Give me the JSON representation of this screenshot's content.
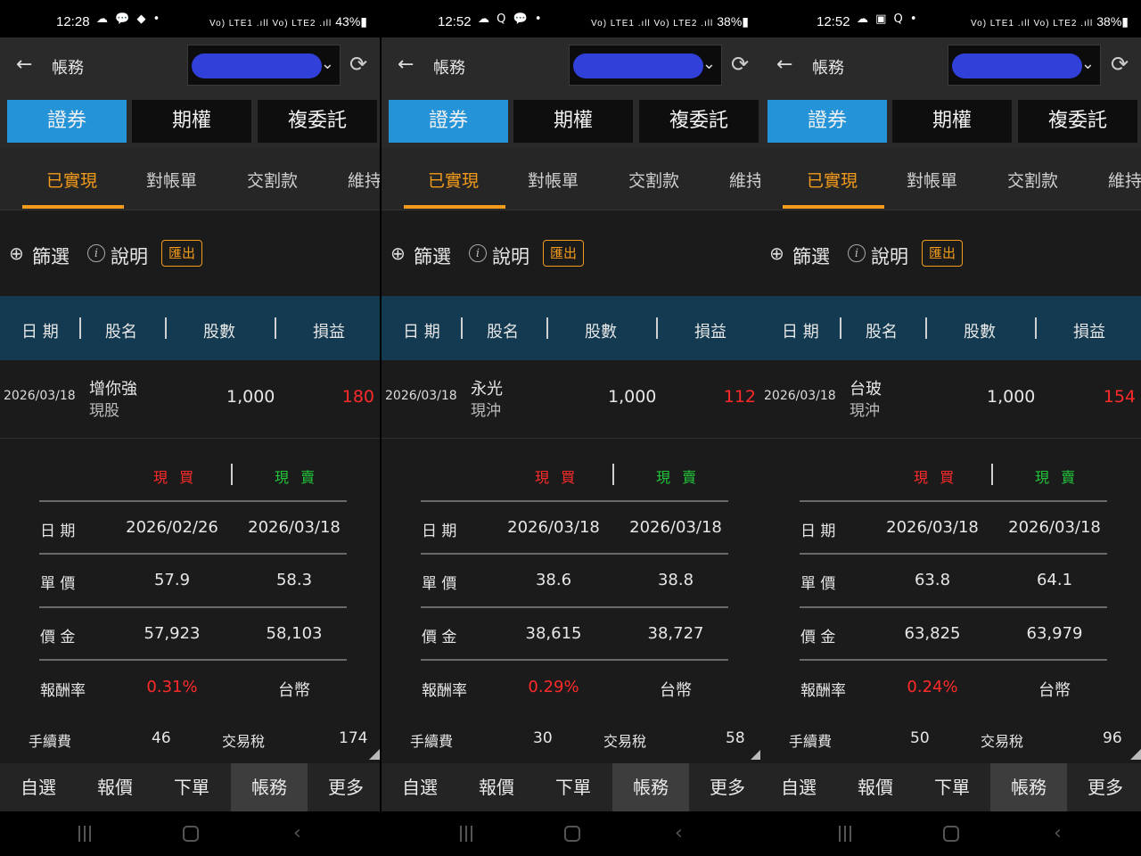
{
  "screens": [
    {
      "status": {
        "time": "12:28",
        "left_icons": "☁ 💬 ◆ •",
        "signal": "Vo) LTE1 .ıll Vo) LTE2 .ıll",
        "battery": "43%"
      },
      "appbar": {
        "title": "帳務",
        "account_redacted": true
      },
      "segments": [
        "證券",
        "期權",
        "複委託"
      ],
      "subtabs": [
        "已實現",
        "對帳單",
        "交割款",
        "維持"
      ],
      "filter": {
        "filter_label": "篩選",
        "info_label": "說明",
        "export_label": "匯出"
      },
      "table_head": [
        "日 期",
        "股名",
        "股數",
        "損益"
      ],
      "row": {
        "date": "2026/03/18",
        "name": "增你強",
        "type": "現股",
        "shares": "1,000",
        "pnl": "180"
      },
      "detail": {
        "buy_label": "現 買",
        "sell_label": "現 賣",
        "date_label": "日 期",
        "buy_date": "2026/02/26",
        "sell_date": "2026/03/18",
        "price_label": "單 價",
        "buy_price": "57.9",
        "sell_price": "58.3",
        "amount_label": "價 金",
        "buy_amount": "57,923",
        "sell_amount": "58,103",
        "return_label": "報酬率",
        "return_rate": "0.31%",
        "currency": "台幣",
        "fee_label": "手續費",
        "fee": "46",
        "tax_label": "交易稅",
        "tax": "174"
      },
      "nav": [
        "自選",
        "報價",
        "下單",
        "帳務",
        "更多"
      ]
    },
    {
      "status": {
        "time": "12:52",
        "left_icons": "☁ Q 💬 •",
        "signal": "Vo) LTE1 .ıll Vo) LTE2 .ıll",
        "battery": "38%"
      },
      "appbar": {
        "title": "帳務",
        "account_redacted": true
      },
      "segments": [
        "證券",
        "期權",
        "複委託"
      ],
      "subtabs": [
        "已實現",
        "對帳單",
        "交割款",
        "維持"
      ],
      "filter": {
        "filter_label": "篩選",
        "info_label": "說明",
        "export_label": "匯出"
      },
      "table_head": [
        "日 期",
        "股名",
        "股數",
        "損益"
      ],
      "row": {
        "date": "2026/03/18",
        "name": "永光",
        "type": "現沖",
        "shares": "1,000",
        "pnl": "112"
      },
      "detail": {
        "buy_label": "現 買",
        "sell_label": "現 賣",
        "date_label": "日 期",
        "buy_date": "2026/03/18",
        "sell_date": "2026/03/18",
        "price_label": "單 價",
        "buy_price": "38.6",
        "sell_price": "38.8",
        "amount_label": "價 金",
        "buy_amount": "38,615",
        "sell_amount": "38,727",
        "return_label": "報酬率",
        "return_rate": "0.29%",
        "currency": "台幣",
        "fee_label": "手續費",
        "fee": "30",
        "tax_label": "交易稅",
        "tax": "58"
      },
      "nav": [
        "自選",
        "報價",
        "下單",
        "帳務",
        "更多"
      ]
    },
    {
      "status": {
        "time": "12:52",
        "left_icons": "☁ ▣ Q •",
        "signal": "Vo) LTE1 .ıll Vo) LTE2 .ıll",
        "battery": "38%"
      },
      "appbar": {
        "title": "帳務",
        "account_redacted": true
      },
      "segments": [
        "證券",
        "期權",
        "複委託"
      ],
      "subtabs": [
        "已實現",
        "對帳單",
        "交割款",
        "維持"
      ],
      "filter": {
        "filter_label": "篩選",
        "info_label": "說明",
        "export_label": "匯出"
      },
      "table_head": [
        "日 期",
        "股名",
        "股數",
        "損益"
      ],
      "row": {
        "date": "2026/03/18",
        "name": "台玻",
        "type": "現沖",
        "shares": "1,000",
        "pnl": "154"
      },
      "detail": {
        "buy_label": "現 買",
        "sell_label": "現 賣",
        "date_label": "日 期",
        "buy_date": "2026/03/18",
        "sell_date": "2026/03/18",
        "price_label": "單 價",
        "buy_price": "63.8",
        "sell_price": "64.1",
        "amount_label": "價 金",
        "buy_amount": "63,825",
        "sell_amount": "63,979",
        "return_label": "報酬率",
        "return_rate": "0.24%",
        "currency": "台幣",
        "fee_label": "手續費",
        "fee": "50",
        "tax_label": "交易稅",
        "tax": "96"
      },
      "nav": [
        "自選",
        "報價",
        "下單",
        "帳務",
        "更多"
      ]
    }
  ],
  "colors": {
    "accent_blue": "#2493d8",
    "accent_orange": "#f39b1c",
    "table_head_bg": "#133a50",
    "profit_red": "#ff2a2a",
    "sell_green": "#22c43a"
  }
}
